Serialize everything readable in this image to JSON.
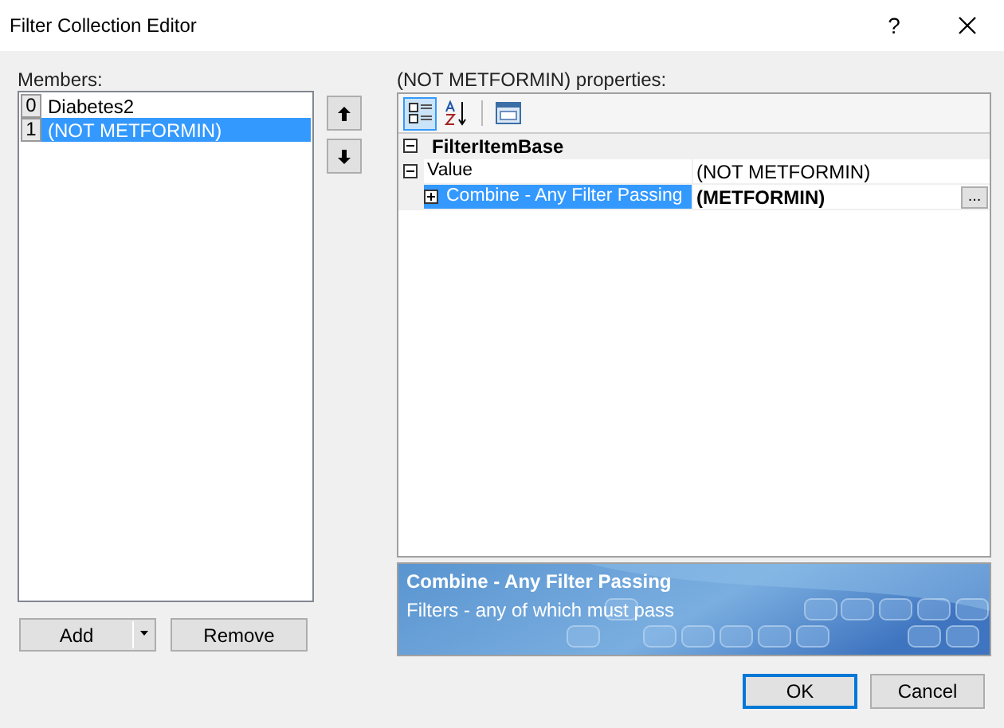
{
  "window": {
    "title": "Filter Collection Editor",
    "help": "?"
  },
  "members": {
    "label": "Members:",
    "items": [
      {
        "index": "0",
        "name": "Diabetes2",
        "selected": false
      },
      {
        "index": "1",
        "name": "(NOT METFORMIN)",
        "selected": true
      }
    ]
  },
  "member_buttons": [
    {
      "label": "Add",
      "kind": "split"
    },
    {
      "label": "Remove",
      "kind": "plain"
    }
  ],
  "properties": {
    "label": "(NOT METFORMIN) properties:",
    "toolbar": [
      {
        "kind": "categorized",
        "selected": true
      },
      {
        "kind": "alphabetical",
        "selected": false
      },
      {
        "kind": "pages",
        "selected": false
      }
    ],
    "category": {
      "name": "FilterItemBase",
      "expanded": true
    },
    "rows": [
      {
        "name": "Value",
        "value": "(NOT METFORMIN)",
        "expanded": true,
        "selected": false,
        "bold_value": false,
        "children": [
          {
            "name": "Combine - Any Filter Passing",
            "value": "(METFORMIN)",
            "expanded": false,
            "selected": true,
            "bold_value": true,
            "ellipsis": "..."
          }
        ]
      }
    ]
  },
  "description": {
    "title": "Combine - Any Filter Passing",
    "text": "Filters - any of which must pass"
  },
  "buttons": [
    {
      "label": "OK",
      "default": true
    },
    {
      "label": "Cancel",
      "default": false
    }
  ]
}
